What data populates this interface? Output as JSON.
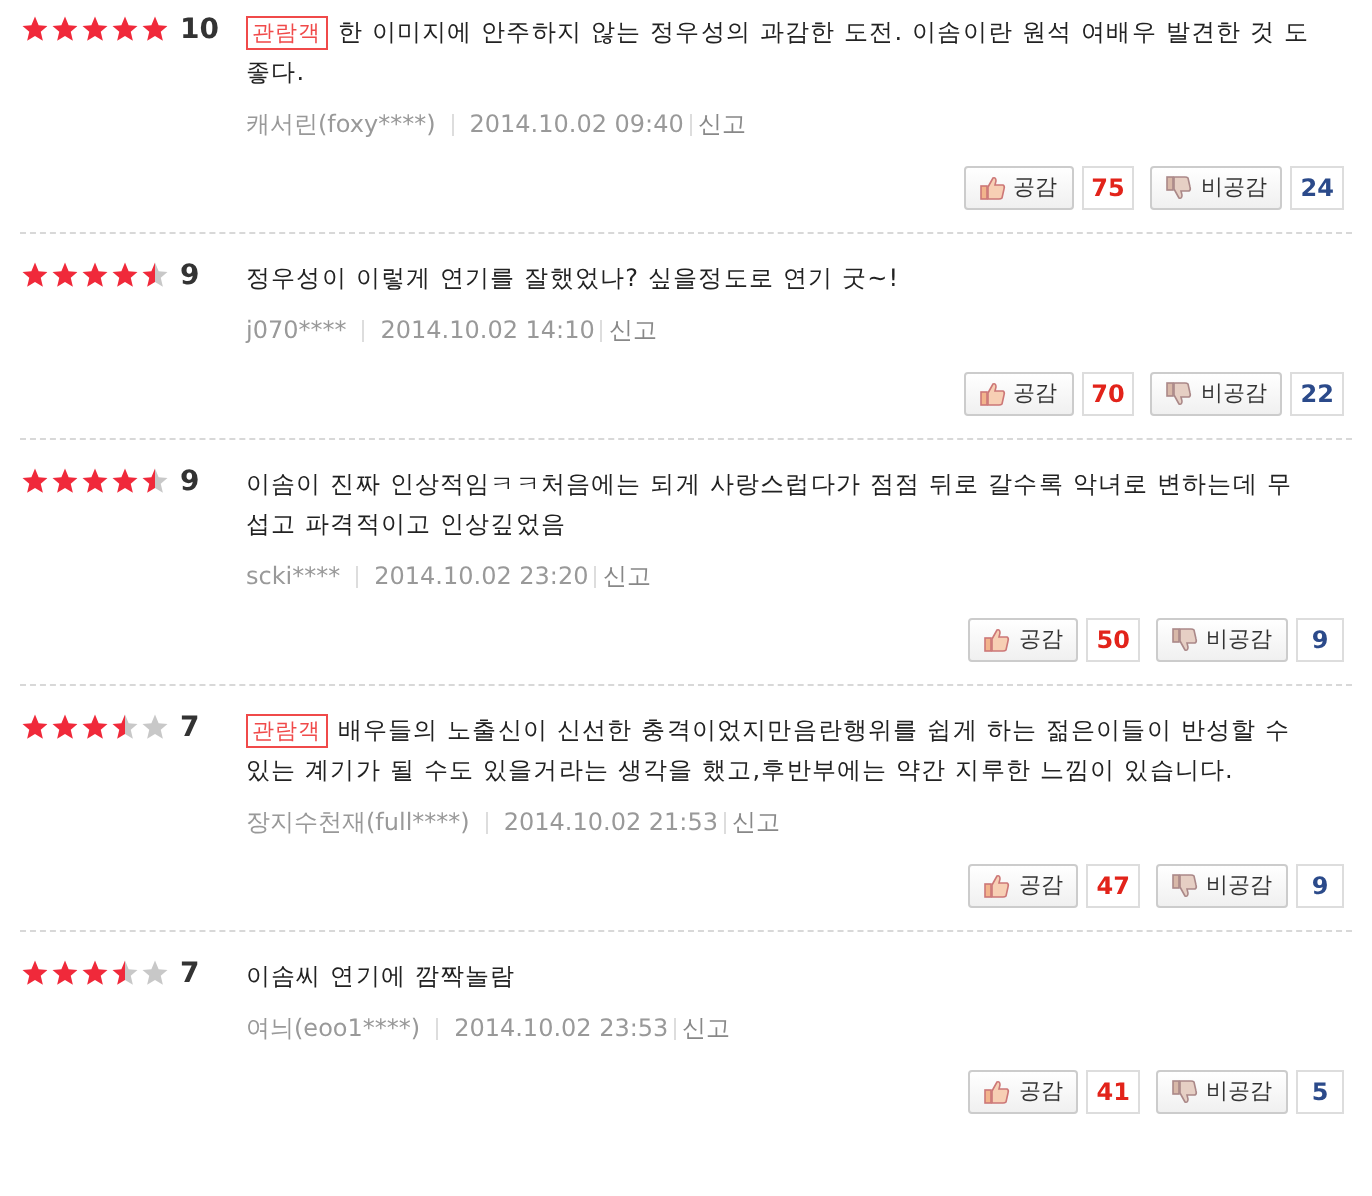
{
  "reviews": [
    {
      "stars": 5,
      "score": "10",
      "badge": "관람객",
      "text": "한 이미지에 안주하지 않는 정우성의 과감한 도전. 이솜이란 원석 여배우 발견한 것 도 좋다.",
      "author": "캐서린(foxy****)",
      "date": "2014.10.02 09:40",
      "report": "신고",
      "like_label": "공감",
      "likes": "75",
      "dislike_label": "비공감",
      "dislikes": "24"
    },
    {
      "stars": 4.5,
      "score": "9",
      "text": "정우성이 이렇게 연기를 잘했었나? 싶을정도로 연기 굿~!",
      "author": "j070****",
      "date": "2014.10.02 14:10",
      "report": "신고",
      "like_label": "공감",
      "likes": "70",
      "dislike_label": "비공감",
      "dislikes": "22"
    },
    {
      "stars": 4.5,
      "score": "9",
      "text": "이솜이 진짜 인상적임ㅋㅋ처음에는 되게 사랑스럽다가 점점 뒤로 갈수록 악녀로 변하는데 무섭고 파격적이고 인상깊었음",
      "author": "scki****",
      "date": "2014.10.02 23:20",
      "report": "신고",
      "like_label": "공감",
      "likes": "50",
      "dislike_label": "비공감",
      "dislikes": "9"
    },
    {
      "stars": 3.5,
      "score": "7",
      "badge": "관람객",
      "text": "배우들의 노출신이 신선한 충격이었지만음란행위를 쉽게 하는 젊은이들이 반성할 수 있는 계기가 될 수도 있을거라는 생각을 했고,후반부에는 약간 지루한 느낌이 있습니다.",
      "author": "장지수천재(full****)",
      "date": "2014.10.02 21:53",
      "report": "신고",
      "like_label": "공감",
      "likes": "47",
      "dislike_label": "비공감",
      "dislikes": "9"
    },
    {
      "stars": 3.5,
      "score": "7",
      "text": "이솜씨 연기에 깜짝놀람",
      "author": "여늬(eoo1****)",
      "date": "2014.10.02 23:53",
      "report": "신고",
      "like_label": "공감",
      "likes": "41",
      "dislike_label": "비공감",
      "dislikes": "5"
    }
  ]
}
